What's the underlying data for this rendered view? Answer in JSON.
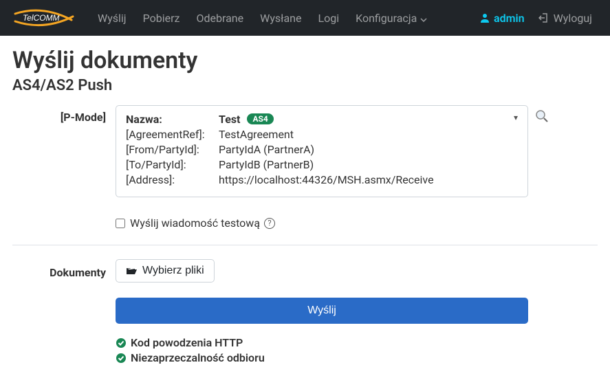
{
  "brand": "TelCOMM",
  "nav": {
    "send": "Wyślij",
    "download": "Pobierz",
    "received": "Odebrane",
    "sent": "Wysłane",
    "logs": "Logi",
    "config": "Konfiguracja"
  },
  "user": {
    "name": "admin",
    "logout": "Wyloguj"
  },
  "page": {
    "title": "Wyślij dokumenty",
    "subtitle": "AS4/AS2 Push"
  },
  "pmode": {
    "section_label": "[P-Mode]",
    "name_key": "Nazwa:",
    "name_value": "Test",
    "protocol_badge": "AS4",
    "agreement_key": "[AgreementRef]:",
    "agreement_value": "TestAgreement",
    "from_key": "[From/PartyId]:",
    "from_value": "PartyIdA (PartnerA)",
    "to_key": "[To/PartyId]:",
    "to_value": "PartyIdB (PartnerB)",
    "address_key": "[Address]:",
    "address_value": "https://localhost:44326/MSH.asmx/Receive"
  },
  "testmsg": {
    "label": "Wyślij wiadomość testową"
  },
  "documents": {
    "section_label": "Dokumenty",
    "choose_files": "Wybierz pliki",
    "send_button": "Wyślij"
  },
  "status": {
    "http_success": "Kod powodzenia HTTP",
    "non_repudiation": "Niezaprzeczalność odbioru"
  }
}
